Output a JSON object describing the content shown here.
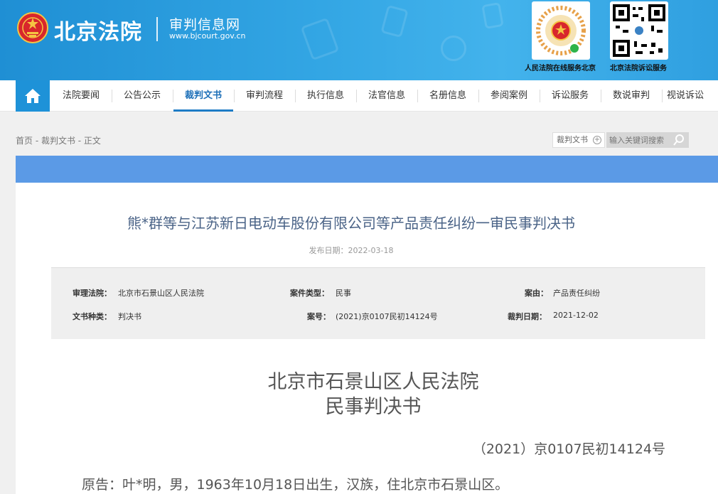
{
  "header": {
    "logo_main": "北京法院",
    "logo_sub": "审判信息网",
    "logo_url": "www.bjcourt.gov.cn",
    "qr_codes": [
      {
        "caption": "人民法院在线服务北京",
        "icon": "court-service-qr-icon"
      },
      {
        "caption": "北京法院诉讼服务",
        "icon": "litigation-service-qr-icon"
      }
    ]
  },
  "nav": {
    "home_icon": "home-icon",
    "items": [
      {
        "label": "法院要闻"
      },
      {
        "label": "公告公示"
      },
      {
        "label": "裁判文书",
        "active": true
      },
      {
        "label": "审判流程"
      },
      {
        "label": "执行信息"
      },
      {
        "label": "法官信息"
      },
      {
        "label": "名册信息"
      },
      {
        "label": "参阅案例"
      },
      {
        "label": "诉讼服务"
      },
      {
        "label": "数说审判"
      },
      {
        "label": "视说诉讼"
      }
    ]
  },
  "breadcrumb": "首页 - 裁判文书 - 正文",
  "search": {
    "category": "裁判文书",
    "placeholder": "输入关键词搜索"
  },
  "document": {
    "title": "熊*群等与江苏新日电动车股份有限公司等产品责任纠纷一审民事判决书",
    "publish_label": "发布日期：",
    "publish_date": "2022-03-18"
  },
  "case_info": {
    "court_label": "审理法院：",
    "court": "北京市石景山区人民法院",
    "case_type_label": "案件类型：",
    "case_type": "民事",
    "cause_label": "案由：",
    "cause": "产品责任纠纷",
    "doc_type_label": "文书种类：",
    "doc_type": "判决书",
    "case_no_label": "案号：",
    "case_no": "(2021)京0107民初14124号",
    "judgment_date_label": "裁判日期：",
    "judgment_date": "2021-12-02"
  },
  "body": {
    "court_name": "北京市石景山区人民法院",
    "doc_type": "民事判决书",
    "case_no": "（2021）京0107民初14124号",
    "plaintiff": "原告：叶*明，男，1963年10月18日出生，汉族，住北京市石景山区。"
  },
  "colors": {
    "header_blue": "#2a9ddf",
    "nav_active": "#1c6fb8",
    "content_bar": "#5b9ae6"
  }
}
